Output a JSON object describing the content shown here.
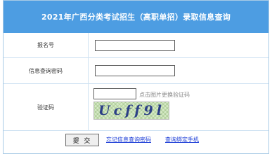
{
  "header": {
    "title": "2021年广西分类考试招生（高职单招）录取信息查询"
  },
  "form": {
    "exam_number_label": "报名号",
    "exam_number_value": "",
    "query_password_label": "信息查询密码",
    "query_password_value": "",
    "captcha_label": "验证码",
    "captcha_value": "",
    "captcha_hint": "点击图片更换验证码",
    "captcha_image_text": "Ucff9l"
  },
  "actions": {
    "submit_label": "提 交",
    "forgot_password_link": "忘记信息查询密码",
    "bind_phone_link": "查询绑定手机"
  },
  "colors": {
    "header_bg": "#4d9de2",
    "link": "#1a3bd6",
    "captcha_text": "#2c3f86"
  }
}
